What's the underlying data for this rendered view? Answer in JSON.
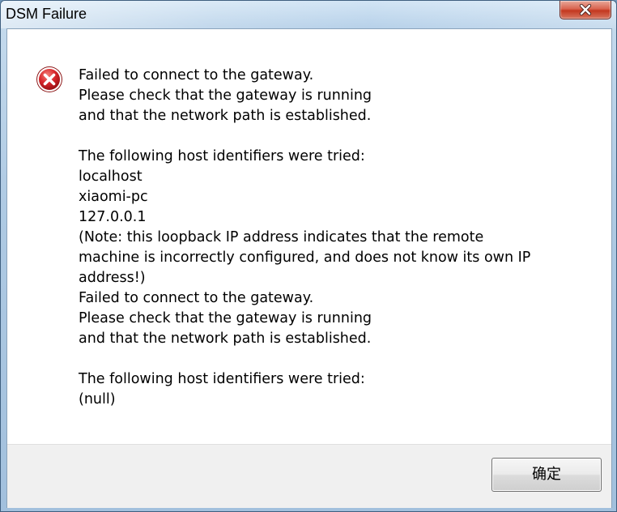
{
  "window": {
    "title": "DSM Failure"
  },
  "message": {
    "lines": [
      "Failed to connect to the gateway.",
      "Please check that the gateway is running",
      "and that the network path is established.",
      "",
      "The following host identifiers were tried:",
      "localhost",
      "xiaomi-pc",
      "127.0.0.1",
      "(Note: this loopback IP address indicates that the remote",
      "machine is incorrectly configured, and does not know its own IP",
      "address!)",
      "Failed to connect to the gateway.",
      "Please check that the gateway is running",
      "and that the network path is established.",
      "",
      "The following host identifiers were tried:",
      "(null)"
    ]
  },
  "buttons": {
    "ok_label": "确定"
  },
  "icons": {
    "error": "error-icon",
    "close": "close-icon"
  },
  "colors": {
    "error_red": "#d8262b",
    "close_red": "#c3381f"
  }
}
